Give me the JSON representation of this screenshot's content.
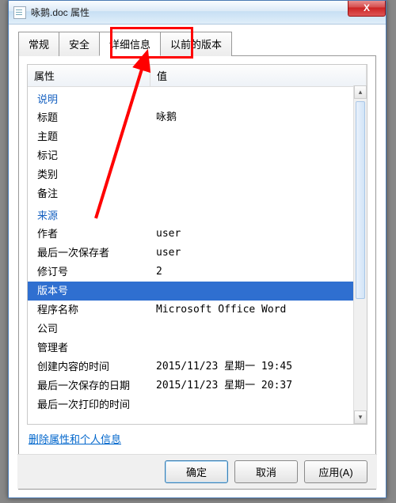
{
  "window": {
    "title": "咏鹅.doc 属性",
    "close": "X"
  },
  "tabs": {
    "general": "常规",
    "security": "安全",
    "details": "详细信息",
    "previous": "以前的版本"
  },
  "headers": {
    "property": "属性",
    "value": "值"
  },
  "groups": {
    "description": "说明",
    "origin": "来源"
  },
  "props": {
    "title": {
      "label": "标题",
      "value": "咏鹅"
    },
    "subject": {
      "label": "主题",
      "value": ""
    },
    "tags": {
      "label": "标记",
      "value": ""
    },
    "category": {
      "label": "类别",
      "value": ""
    },
    "comments": {
      "label": "备注",
      "value": ""
    },
    "author": {
      "label": "作者",
      "value": "user"
    },
    "lastSavedBy": {
      "label": "最后一次保存者",
      "value": "user"
    },
    "revision": {
      "label": "修订号",
      "value": "2"
    },
    "version": {
      "label": "版本号",
      "value": ""
    },
    "program": {
      "label": "程序名称",
      "value": "Microsoft Office Word"
    },
    "company": {
      "label": "公司",
      "value": ""
    },
    "manager": {
      "label": "管理者",
      "value": ""
    },
    "created": {
      "label": "创建内容的时间",
      "value": "2015/11/23 星期一 19:45"
    },
    "lastSaved": {
      "label": "最后一次保存的日期",
      "value": "2015/11/23 星期一 20:37"
    },
    "lastPrinted": {
      "label": "最后一次打印的时间",
      "value": ""
    }
  },
  "link": "删除属性和个人信息",
  "buttons": {
    "ok": "确定",
    "cancel": "取消",
    "apply": "应用(A)"
  }
}
